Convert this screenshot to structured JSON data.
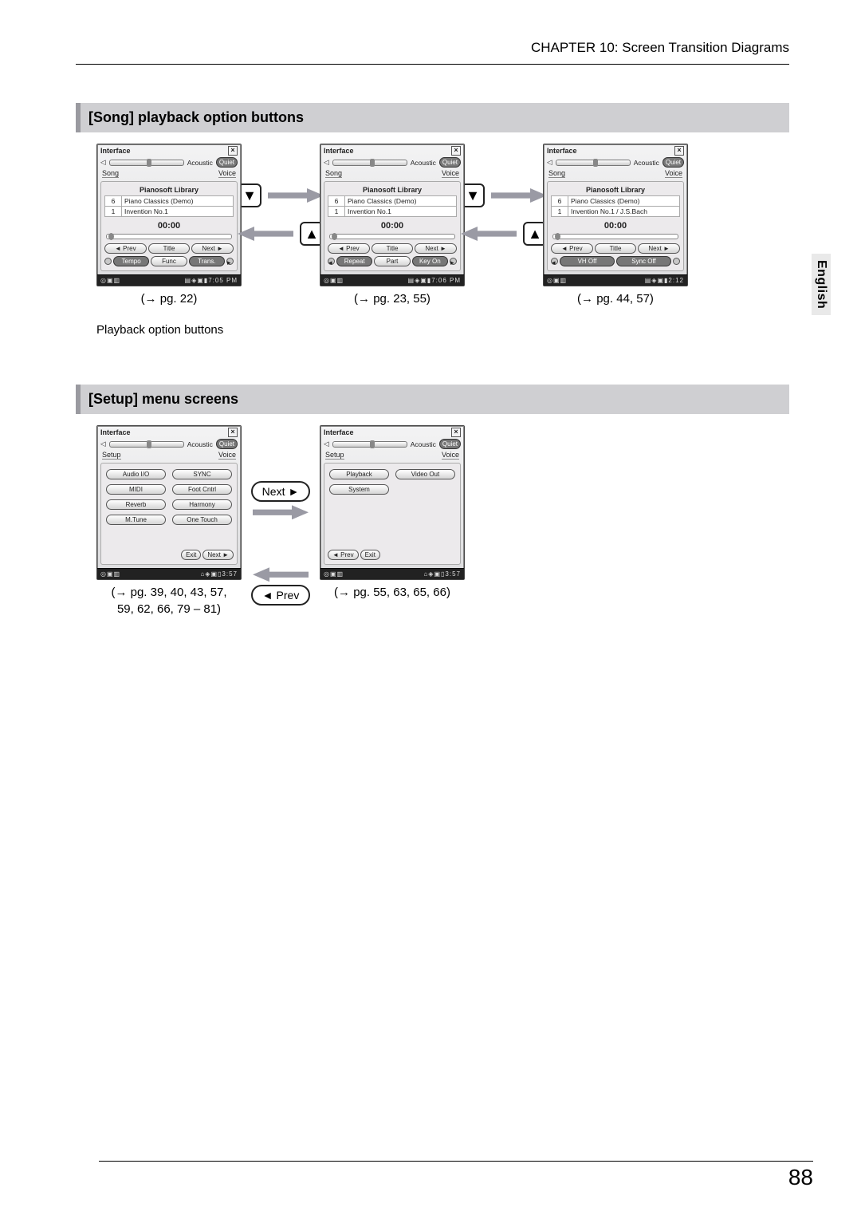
{
  "chapter_header": "CHAPTER 10: Screen Transition Diagrams",
  "side_tab": "English",
  "page_number": "88",
  "section1": {
    "title": "[Song] playback option buttons",
    "playback_label": "Playback option buttons",
    "cap1": "(→ pg. 22)",
    "cap2": "(→ pg. 23, 55)",
    "cap3": "(→ pg. 44, 57)"
  },
  "section2": {
    "title": "[Setup] menu screens",
    "cap1a": "(→ pg. 39, 40, 43, 57,",
    "cap1b": "59, 62, 66, 79 – 81)",
    "cap2": "(→ pg. 55, 63, 65, 66)",
    "nav_next": "Next",
    "nav_prev": "Prev"
  },
  "mini_common": {
    "titlebar": "Interface",
    "acoustic": "Acoustic",
    "quiet": "Quiet",
    "voice": "Voice",
    "close": "×"
  },
  "song_screen": {
    "tab": "Song",
    "lib": "Pianosoft Library",
    "row1_no": "6",
    "row1_title": "Piano Classics (Demo)",
    "row2_no": "1",
    "row2a_title": "Invention No.1",
    "row2c_title": "Invention No.1 / J.S.Bach",
    "time": "00:00",
    "prev": "Prev",
    "title_btn": "Title",
    "next": "Next",
    "a_tempo": "Tempo",
    "a_func": "Func",
    "a_trans": "Trans.",
    "b_repeat": "Repeat",
    "b_part": "Part",
    "b_keyon": "Key On",
    "c_vhoff": "VH Off",
    "c_sync": "Sync Off",
    "status_a": "7:05 PM",
    "status_b": "7:06 PM",
    "status_c": "2:12"
  },
  "setup_screen": {
    "tab": "Setup",
    "a_audio": "Audio I/O",
    "a_sync": "SYNC",
    "a_midi": "MIDI",
    "a_foot": "Foot Cntrl",
    "a_reverb": "Reverb",
    "a_harmony": "Harmony",
    "a_mtune": "M.Tune",
    "a_onetouch": "One Touch",
    "b_playback": "Playback",
    "b_videoout": "Video Out",
    "b_system": "System",
    "exit": "Exit",
    "next": "Next",
    "prev": "Prev",
    "status": "3:57"
  }
}
